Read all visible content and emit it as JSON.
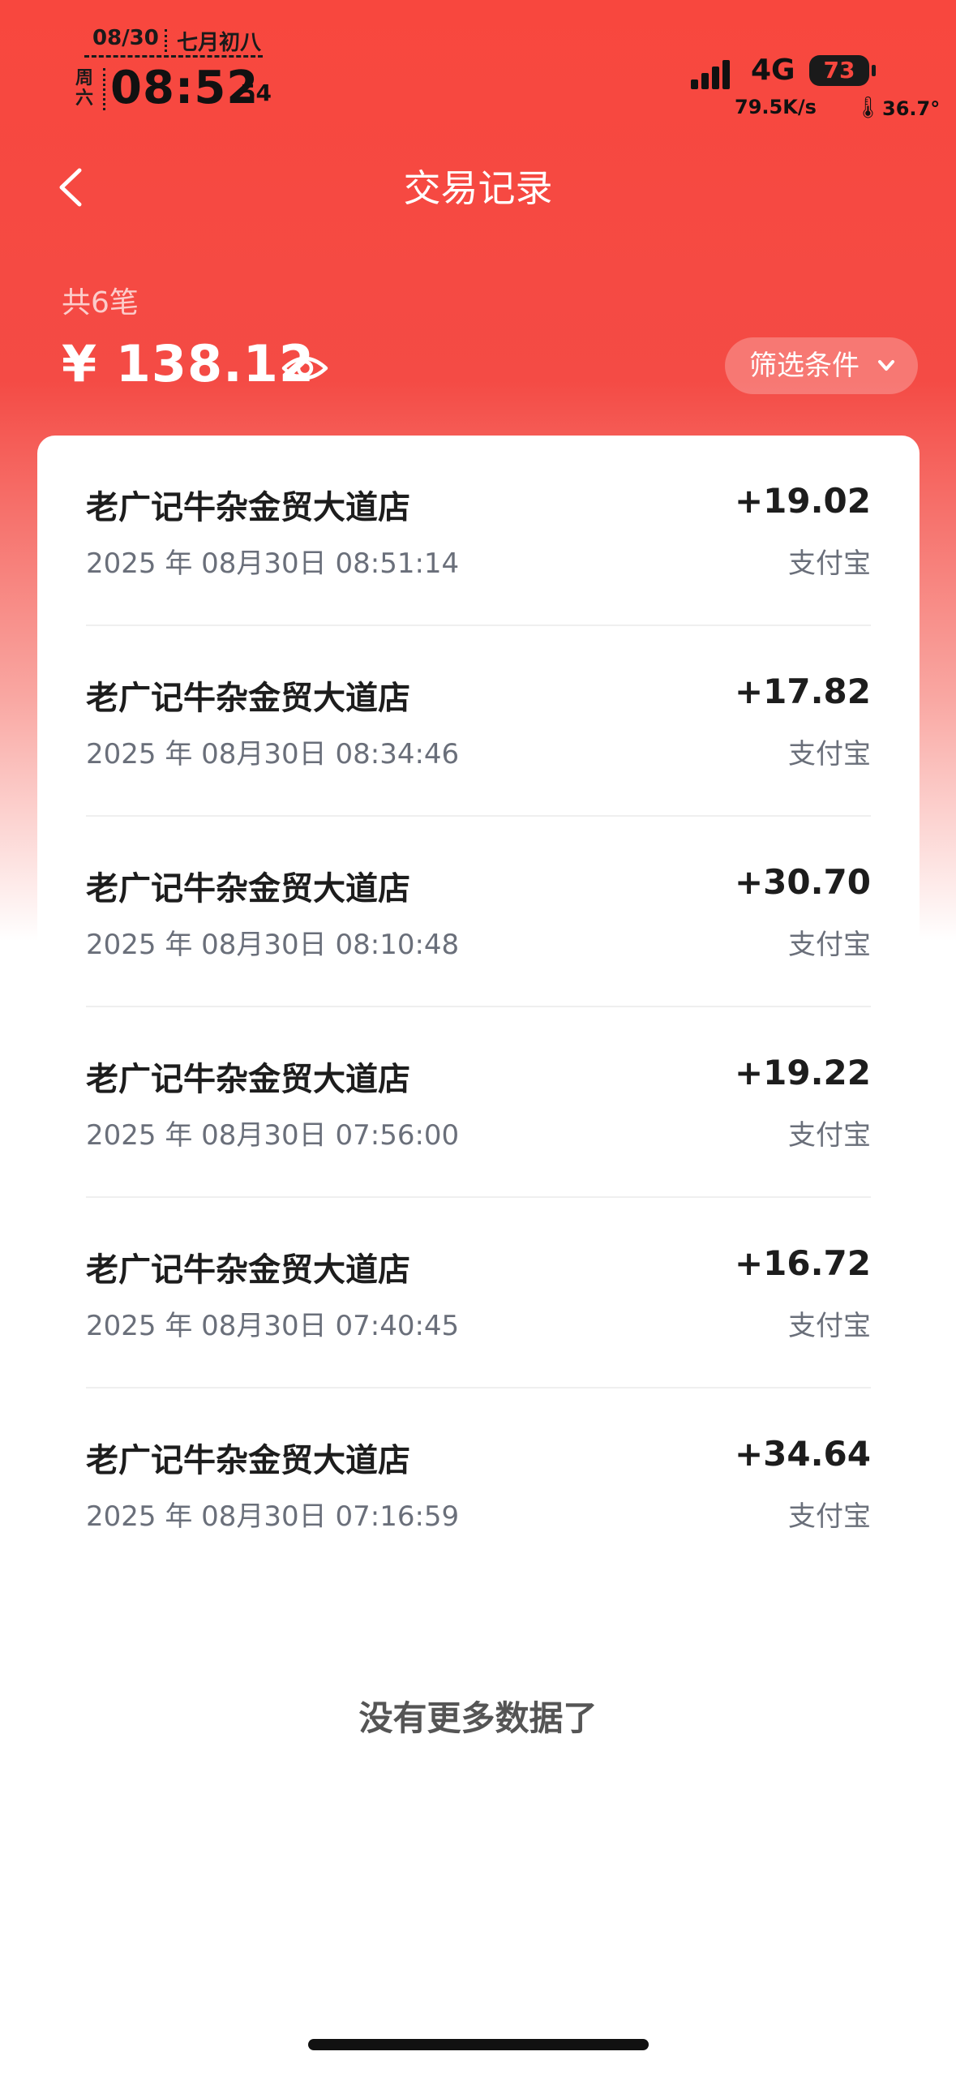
{
  "status_bar": {
    "date": "08/30",
    "lunar": "七月初八",
    "weekday": "周六",
    "time": "08:52",
    "seconds": "54",
    "network": "4G",
    "battery": "73",
    "speed": "79.5K/s",
    "temperature": "36.7°",
    "temperature_icon": "thermometer-icon"
  },
  "nav": {
    "title": "交易记录",
    "back_icon": "chevron-left-icon"
  },
  "summary": {
    "count": "共6笔",
    "total": "¥ 138.12",
    "eye_icon": "eye-icon",
    "filter_label": "筛选条件"
  },
  "transactions": [
    {
      "name": "老广记牛杂金贸大道店",
      "time": "2025 年 08月30日 08:51:14",
      "amount": "+19.02",
      "method": "支付宝"
    },
    {
      "name": "老广记牛杂金贸大道店",
      "time": "2025 年 08月30日 08:34:46",
      "amount": "+17.82",
      "method": "支付宝"
    },
    {
      "name": "老广记牛杂金贸大道店",
      "time": "2025 年 08月30日 08:10:48",
      "amount": "+30.70",
      "method": "支付宝"
    },
    {
      "name": "老广记牛杂金贸大道店",
      "time": "2025 年 08月30日 07:56:00",
      "amount": "+19.22",
      "method": "支付宝"
    },
    {
      "name": "老广记牛杂金贸大道店",
      "time": "2025 年 08月30日 07:40:45",
      "amount": "+16.72",
      "method": "支付宝"
    },
    {
      "name": "老广记牛杂金贸大道店",
      "time": "2025 年 08月30日 07:16:59",
      "amount": "+34.64",
      "method": "支付宝"
    }
  ],
  "footer": {
    "end_text": "没有更多数据了"
  },
  "colors": {
    "brand_red": "#F8473E",
    "text_dark": "#1d1d1d",
    "text_muted": "#6a6f7a"
  }
}
